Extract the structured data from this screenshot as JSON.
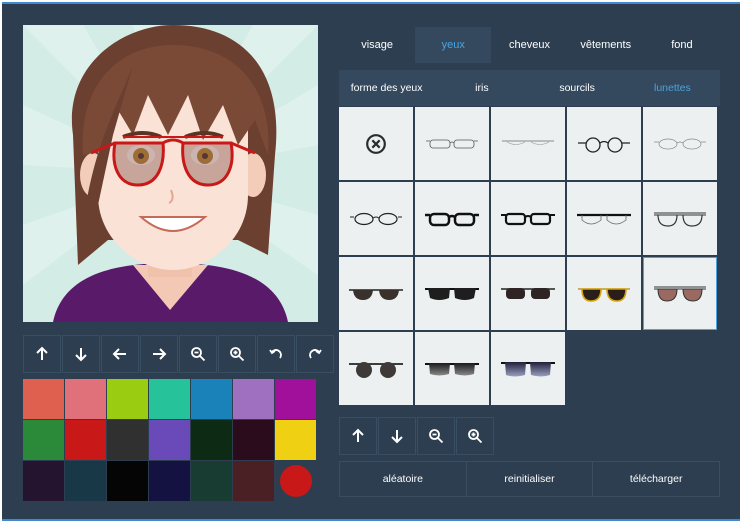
{
  "colors": {
    "background": "#2c3e50",
    "accent": "#4aa3df",
    "cell": "#ecf0f1"
  },
  "tabs": [
    {
      "label": "visage",
      "active": false
    },
    {
      "label": "yeux",
      "active": true
    },
    {
      "label": "cheveux",
      "active": false
    },
    {
      "label": "vêtements",
      "active": false
    },
    {
      "label": "fond",
      "active": false
    }
  ],
  "subtabs": [
    {
      "label": "forme des yeux",
      "active": false
    },
    {
      "label": "iris",
      "active": false
    },
    {
      "label": "sourcils",
      "active": false
    },
    {
      "label": "lunettes",
      "active": true
    }
  ],
  "preview_controls": [
    "arrow-up-icon",
    "arrow-down-icon",
    "arrow-left-icon",
    "arrow-right-icon",
    "zoom-out-icon",
    "zoom-in-icon",
    "undo-icon",
    "redo-icon"
  ],
  "palette": [
    "#e06050",
    "#e0707a",
    "#9acd12",
    "#26c29a",
    "#1a82b8",
    "#a070c0",
    "#a0109a",
    "#2a8a3a",
    "#c81818",
    "#303030",
    "#6a4ab8",
    "#0c2a14",
    "#2a0c1c",
    "#f0d012",
    "#241430",
    "#183848",
    "#050505",
    "#141240",
    "#183c32",
    "#4a2024"
  ],
  "current_color": "#c81818",
  "glasses": [
    {
      "icon": "none-icon"
    },
    {
      "icon": "thin-rectangular-glasses-icon"
    },
    {
      "icon": "rimless-glasses-icon"
    },
    {
      "icon": "round-glasses-icon"
    },
    {
      "icon": "thin-oval-glasses-icon"
    },
    {
      "icon": "oval-glasses-icon"
    },
    {
      "icon": "thick-black-glasses-icon"
    },
    {
      "icon": "black-rectangular-glasses-icon"
    },
    {
      "icon": "browline-glasses-icon"
    },
    {
      "icon": "aviator-thin-glasses-icon"
    },
    {
      "icon": "dark-sunglasses-icon"
    },
    {
      "icon": "wayfarer-sunglasses-icon"
    },
    {
      "icon": "brown-sunglasses-icon"
    },
    {
      "icon": "gold-aviator-sunglasses-icon"
    },
    {
      "icon": "pink-aviator-sunglasses-icon",
      "selected": true
    },
    {
      "icon": "round-sunglasses-icon"
    },
    {
      "icon": "gradient-sunglasses-icon"
    },
    {
      "icon": "mirrored-sunglasses-icon"
    }
  ],
  "item_controls": [
    "arrow-up-icon",
    "arrow-down-icon",
    "zoom-out-icon",
    "zoom-in-icon"
  ],
  "actions": {
    "random": "aléatoire",
    "reset": "reinitialiser",
    "download": "télécharger"
  }
}
